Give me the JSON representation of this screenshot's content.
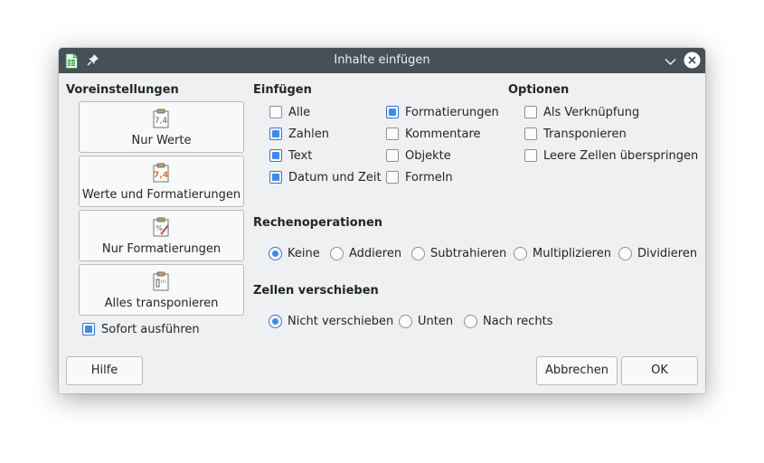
{
  "window": {
    "title": "Inhalte einfügen",
    "icons": [
      "spreadsheet-icon",
      "pin-icon",
      "minimize-icon",
      "close-icon"
    ]
  },
  "presets": {
    "heading": "Voreinstellungen",
    "buttons": [
      {
        "label": "Nur Werte",
        "icon": "values-only-icon"
      },
      {
        "label": "Werte und Formatierungen",
        "icon": "values-formats-icon"
      },
      {
        "label": "Nur Formatierungen",
        "icon": "formats-only-icon"
      },
      {
        "label": "Alles transponieren",
        "icon": "transpose-all-icon"
      }
    ],
    "run_immediately": {
      "label": "Sofort ausführen",
      "checked": true
    }
  },
  "paste": {
    "heading": "Einfügen",
    "options": [
      {
        "label": "Alle",
        "checked": false
      },
      {
        "label": "Zahlen",
        "checked": true
      },
      {
        "label": "Text",
        "checked": true
      },
      {
        "label": "Datum und Zeit",
        "checked": true
      },
      {
        "label": "Formatierungen",
        "checked": true
      },
      {
        "label": "Kommentare",
        "checked": false
      },
      {
        "label": "Objekte",
        "checked": false
      },
      {
        "label": "Formeln",
        "checked": false
      }
    ]
  },
  "options": {
    "heading": "Optionen",
    "items": [
      {
        "label": "Als Verknüpfung",
        "checked": false
      },
      {
        "label": "Transponieren",
        "checked": false
      },
      {
        "label": "Leere Zellen überspringen",
        "checked": false
      }
    ]
  },
  "operations": {
    "heading": "Rechenoperationen",
    "items": [
      {
        "label": "Keine",
        "selected": true
      },
      {
        "label": "Addieren",
        "selected": false
      },
      {
        "label": "Subtrahieren",
        "selected": false
      },
      {
        "label": "Multiplizieren",
        "selected": false
      },
      {
        "label": "Dividieren",
        "selected": false
      }
    ]
  },
  "shift": {
    "heading": "Zellen verschieben",
    "items": [
      {
        "label": "Nicht verschieben",
        "selected": true
      },
      {
        "label": "Unten",
        "selected": false
      },
      {
        "label": "Nach rechts",
        "selected": false
      }
    ]
  },
  "footer": {
    "help": "Hilfe",
    "cancel": "Abbrechen",
    "ok": "OK"
  },
  "colors": {
    "titlebar": "#475057",
    "dialog_bg": "#eff0f1",
    "accent": "#3d8bf0"
  }
}
